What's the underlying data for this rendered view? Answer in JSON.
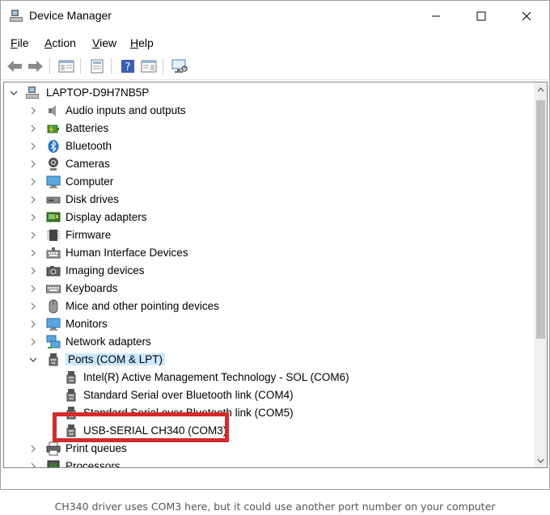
{
  "window": {
    "title": "Device Manager"
  },
  "menu": [
    {
      "label": "File",
      "key": "F",
      "rest": "ile"
    },
    {
      "label": "Action",
      "key": "A",
      "rest": "ction"
    },
    {
      "label": "View",
      "key": "V",
      "rest": "iew"
    },
    {
      "label": "Help",
      "key": "H",
      "rest": "elp"
    }
  ],
  "tree": {
    "root": "LAPTOP-D9H7NB5P",
    "categories": [
      "Audio inputs and outputs",
      "Batteries",
      "Bluetooth",
      "Cameras",
      "Computer",
      "Disk drives",
      "Display adapters",
      "Firmware",
      "Human Interface Devices",
      "Imaging devices",
      "Keyboards",
      "Mice and other pointing devices",
      "Monitors",
      "Network adapters",
      "Ports (COM & LPT)"
    ],
    "ports_children": [
      "Intel(R) Active Management Technology - SOL (COM6)",
      "Standard Serial over Bluetooth link (COM4)",
      "Standard Serial over Bluetooth link (COM5)",
      "USB-SERIAL CH340 (COM3)"
    ],
    "after": [
      "Print queues",
      "Processors"
    ]
  },
  "caption": "CH340 driver uses COM3 here, but it could use another port number on your computer",
  "colors": {
    "highlight": "#d42a2a",
    "selection": "#cce8ff"
  }
}
